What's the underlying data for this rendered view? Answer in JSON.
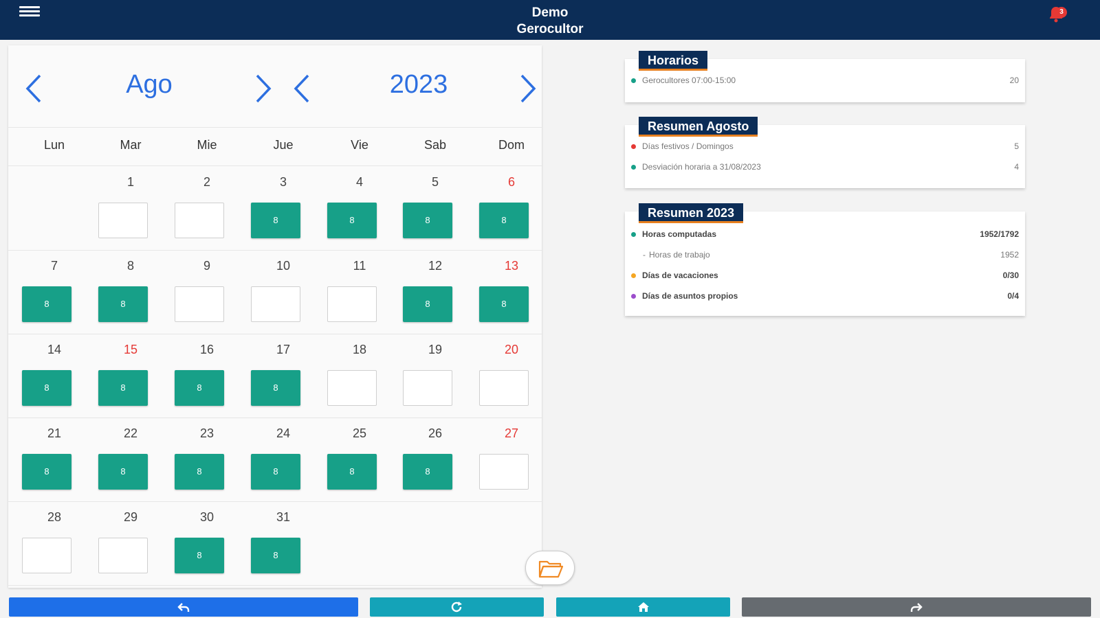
{
  "header": {
    "title_line1": "Demo",
    "title_line2": "Gerocultor",
    "notification_count": "3"
  },
  "calendar": {
    "month": "Ago",
    "year": "2023",
    "weekdays": [
      "Lun",
      "Mar",
      "Mie",
      "Jue",
      "Vie",
      "Sab",
      "Dom"
    ],
    "weeks": [
      [
        null,
        {
          "day": "1",
          "filled": false,
          "holiday": false,
          "value": ""
        },
        {
          "day": "2",
          "filled": false,
          "holiday": false,
          "value": ""
        },
        {
          "day": "3",
          "filled": true,
          "holiday": false,
          "value": "8"
        },
        {
          "day": "4",
          "filled": true,
          "holiday": false,
          "value": "8"
        },
        {
          "day": "5",
          "filled": true,
          "holiday": false,
          "value": "8"
        },
        {
          "day": "6",
          "filled": true,
          "holiday": true,
          "value": "8"
        }
      ],
      [
        {
          "day": "7",
          "filled": true,
          "holiday": false,
          "value": "8"
        },
        {
          "day": "8",
          "filled": true,
          "holiday": false,
          "value": "8"
        },
        {
          "day": "9",
          "filled": false,
          "holiday": false,
          "value": ""
        },
        {
          "day": "10",
          "filled": false,
          "holiday": false,
          "value": ""
        },
        {
          "day": "11",
          "filled": false,
          "holiday": false,
          "value": ""
        },
        {
          "day": "12",
          "filled": true,
          "holiday": false,
          "value": "8"
        },
        {
          "day": "13",
          "filled": true,
          "holiday": true,
          "value": "8"
        }
      ],
      [
        {
          "day": "14",
          "filled": true,
          "holiday": false,
          "value": "8"
        },
        {
          "day": "15",
          "filled": true,
          "holiday": true,
          "value": "8"
        },
        {
          "day": "16",
          "filled": true,
          "holiday": false,
          "value": "8"
        },
        {
          "day": "17",
          "filled": true,
          "holiday": false,
          "value": "8"
        },
        {
          "day": "18",
          "filled": false,
          "holiday": false,
          "value": ""
        },
        {
          "day": "19",
          "filled": false,
          "holiday": false,
          "value": ""
        },
        {
          "day": "20",
          "filled": false,
          "holiday": true,
          "value": ""
        }
      ],
      [
        {
          "day": "21",
          "filled": true,
          "holiday": false,
          "value": "8"
        },
        {
          "day": "22",
          "filled": true,
          "holiday": false,
          "value": "8"
        },
        {
          "day": "23",
          "filled": true,
          "holiday": false,
          "value": "8"
        },
        {
          "day": "24",
          "filled": true,
          "holiday": false,
          "value": "8"
        },
        {
          "day": "25",
          "filled": true,
          "holiday": false,
          "value": "8"
        },
        {
          "day": "26",
          "filled": true,
          "holiday": false,
          "value": "8"
        },
        {
          "day": "27",
          "filled": false,
          "holiday": true,
          "value": ""
        }
      ],
      [
        {
          "day": "28",
          "filled": false,
          "holiday": false,
          "value": ""
        },
        {
          "day": "29",
          "filled": false,
          "holiday": false,
          "value": ""
        },
        {
          "day": "30",
          "filled": true,
          "holiday": false,
          "value": "8"
        },
        {
          "day": "31",
          "filled": true,
          "holiday": false,
          "value": "8"
        },
        null,
        null,
        null
      ]
    ]
  },
  "cards": {
    "horarios": {
      "title": "Horarios",
      "rows": [
        {
          "label": "Gerocultores 07:00-15:00",
          "value": "20",
          "dot_color": "#17a088"
        }
      ]
    },
    "resumen_mes": {
      "title": "Resumen Agosto",
      "rows": [
        {
          "label": "Días festivos / Domingos",
          "value": "5",
          "dot_color": "#e53935"
        },
        {
          "label": "Desviación horaria a 31/08/2023",
          "value": "4",
          "dot_color": "#17a088"
        }
      ]
    },
    "resumen_anio": {
      "title": "Resumen 2023",
      "rows": [
        {
          "label": "Horas computadas",
          "value": "1952/1792",
          "dot_color": "#17a088",
          "bold": true
        },
        {
          "label": "Horas de trabajo",
          "value": "1952",
          "sub": true
        },
        {
          "label": "Días de vacaciones",
          "value": "0/30",
          "dot_color": "#f5a623",
          "bold": true
        },
        {
          "label": "Días de asuntos propios",
          "value": "0/4",
          "dot_color": "#9c4dcc",
          "bold": true
        }
      ]
    }
  },
  "colors": {
    "header_bg": "#0c2d57",
    "accent_blue": "#2d6fe0",
    "teal": "#17a088",
    "holiday_red": "#e53935",
    "tag_underline": "#e8801f",
    "toolbar_blue": "#1e6fe8",
    "toolbar_teal": "#14a3b8",
    "toolbar_gray": "#666b70"
  },
  "toolbar": [
    {
      "name": "back-button",
      "icon": "undo-icon",
      "color": "#1e6fe8"
    },
    {
      "name": "refresh-button",
      "icon": "refresh-icon",
      "color": "#14a3b8"
    },
    {
      "name": "home-button",
      "icon": "home-icon",
      "color": "#14a3b8"
    },
    {
      "name": "forward-button",
      "icon": "redo-icon",
      "color": "#666b70"
    }
  ]
}
